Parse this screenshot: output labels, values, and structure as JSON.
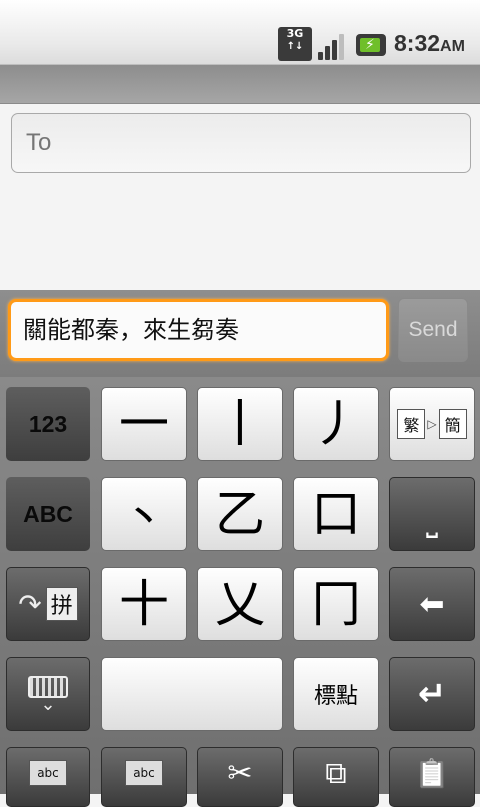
{
  "status_bar": {
    "network": "3G",
    "network_arrows": "↑↓",
    "time": "8:32",
    "ampm": "AM",
    "battery_bolt": "⚡"
  },
  "compose": {
    "to_placeholder": "To",
    "message_text": "關能都秦，來生芻奏",
    "send_label": "Send"
  },
  "keyboard": {
    "mode_numbers": "123",
    "mode_abc": "ABC",
    "mode_pinyin": "拼",
    "mode_pinyin_arrow": "↷",
    "strokes": [
      "一",
      "丨",
      "丿",
      "丶",
      "乙",
      "口",
      "十",
      "乂",
      "冂"
    ],
    "trad_simp": [
      "繁",
      "▷",
      "簡"
    ],
    "space": "⎵",
    "backspace": "⬅",
    "punctuation": "標點",
    "enter": "↵",
    "keyboard_hide_arrow": "⌄",
    "edit_select_abc": "abc",
    "edit_cursor_abc": "abc",
    "cut": "✂",
    "copy": "⧉",
    "paste": "📋"
  }
}
